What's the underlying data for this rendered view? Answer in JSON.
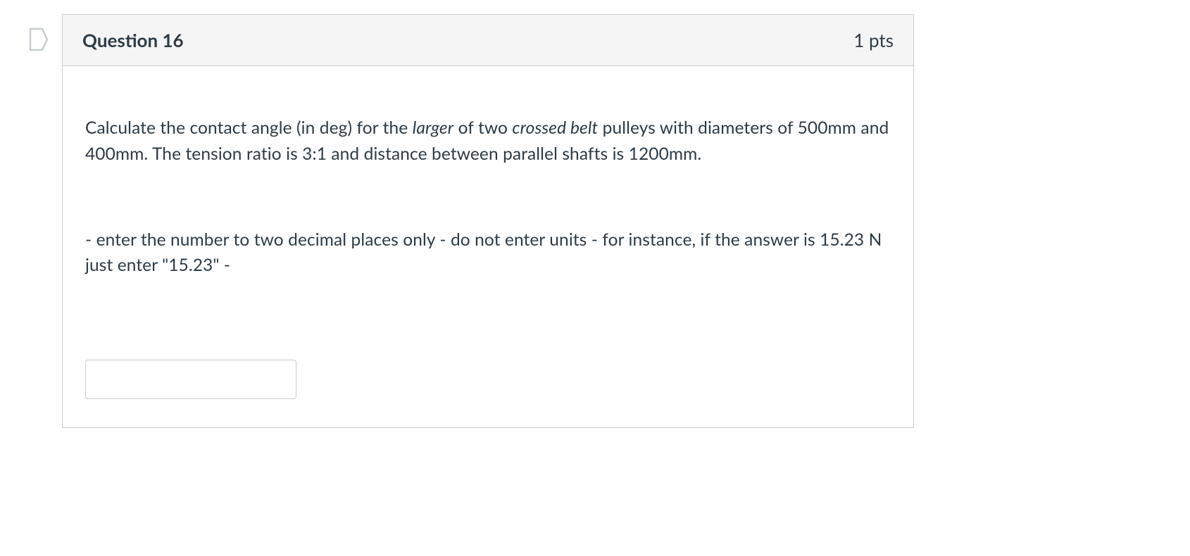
{
  "question": {
    "title": "Question 16",
    "points": "1 pts",
    "body": {
      "p1_pre": "Calculate the contact angle (in deg) for the ",
      "p1_italic1": "larger",
      "p1_mid": " of two ",
      "p1_italic2": "crossed belt",
      "p1_post": " pulleys with diameters of 500mm and 400mm. The tension ratio is 3:1 and distance between parallel shafts is 1200mm.",
      "p2": "- enter the number to two decimal places only - do not enter units - for instance, if the answer is 15.23 N just enter \"15.23\" -"
    },
    "answer_value": ""
  }
}
